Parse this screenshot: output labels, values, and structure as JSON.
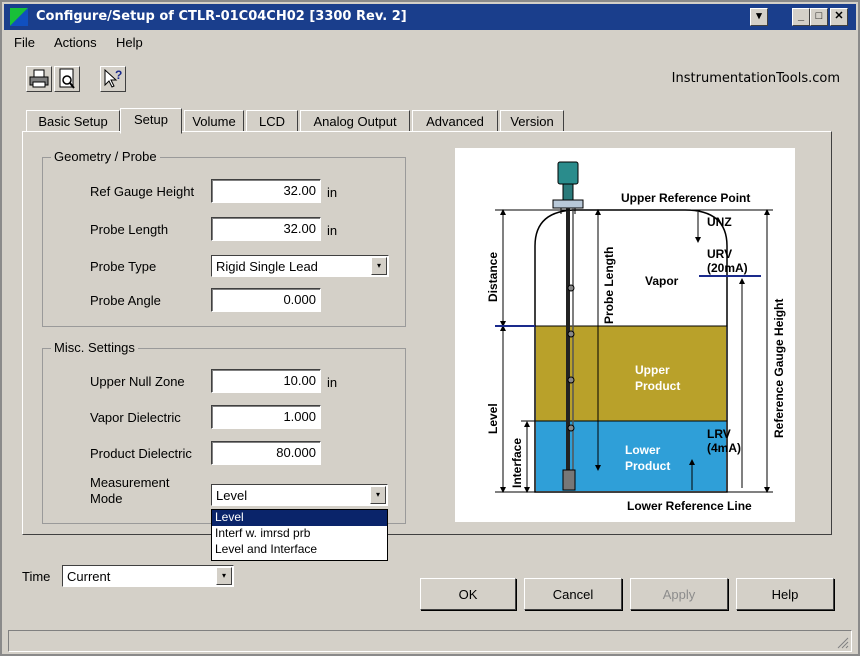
{
  "window": {
    "title": "Configure/Setup of CTLR-01C04CH02 [3300 Rev. 2]",
    "dropdown_glyph": "▾",
    "minimize_glyph": "_",
    "maximize_glyph": "□",
    "close_glyph": "✕"
  },
  "menu": {
    "file": "File",
    "actions": "Actions",
    "help": "Help"
  },
  "toolbar": {
    "brand": "InstrumentationTools.com"
  },
  "tabs": [
    "Basic Setup",
    "Setup",
    "Volume",
    "LCD",
    "Analog Output",
    "Advanced",
    "Version"
  ],
  "geometry": {
    "title": "Geometry / Probe",
    "ref_gauge_height": {
      "label": "Ref Gauge Height",
      "value": "32.00",
      "unit": "in"
    },
    "probe_length": {
      "label": "Probe Length",
      "value": "32.00",
      "unit": "in"
    },
    "probe_type": {
      "label": "Probe Type",
      "value": "Rigid Single Lead"
    },
    "probe_angle": {
      "label": "Probe Angle",
      "value": "0.000"
    }
  },
  "misc": {
    "title": "Misc. Settings",
    "upper_null_zone": {
      "label": "Upper Null Zone",
      "value": "10.00",
      "unit": "in"
    },
    "vapor_dielectric": {
      "label": "Vapor Dielectric",
      "value": "1.000"
    },
    "product_dielectric": {
      "label": "Product Dielectric",
      "value": "80.000"
    },
    "measurement_mode": {
      "label_line1": "Measurement",
      "label_line2": "Mode",
      "value": "Level",
      "options": [
        "Level",
        "Interf w. imrsd prb",
        "Level and Interface"
      ]
    }
  },
  "diagram": {
    "upper_reference_point": "Upper Reference Point",
    "unz": "UNZ",
    "urv": "URV",
    "urv_ma": "(20mA)",
    "vapor": "Vapor",
    "upper_product_1": "Upper",
    "upper_product_2": "Product",
    "lower_product_1": "Lower",
    "lower_product_2": "Product",
    "lrv": "LRV",
    "lrv_ma": "(4mA)",
    "lower_reference_line": "Lower Reference Line",
    "distance": "Distance",
    "probe_length": "Probe Length",
    "reference_gauge_height": "Reference Gauge Height",
    "level": "Level",
    "interface": "Interface",
    "colors": {
      "upper_product": "#b9a12a",
      "lower_product": "#2f9fd8",
      "marker": "#1a2a8c"
    }
  },
  "time": {
    "label": "Time",
    "value": "Current"
  },
  "buttons": {
    "ok": "OK",
    "cancel": "Cancel",
    "apply": "Apply",
    "help": "Help"
  }
}
